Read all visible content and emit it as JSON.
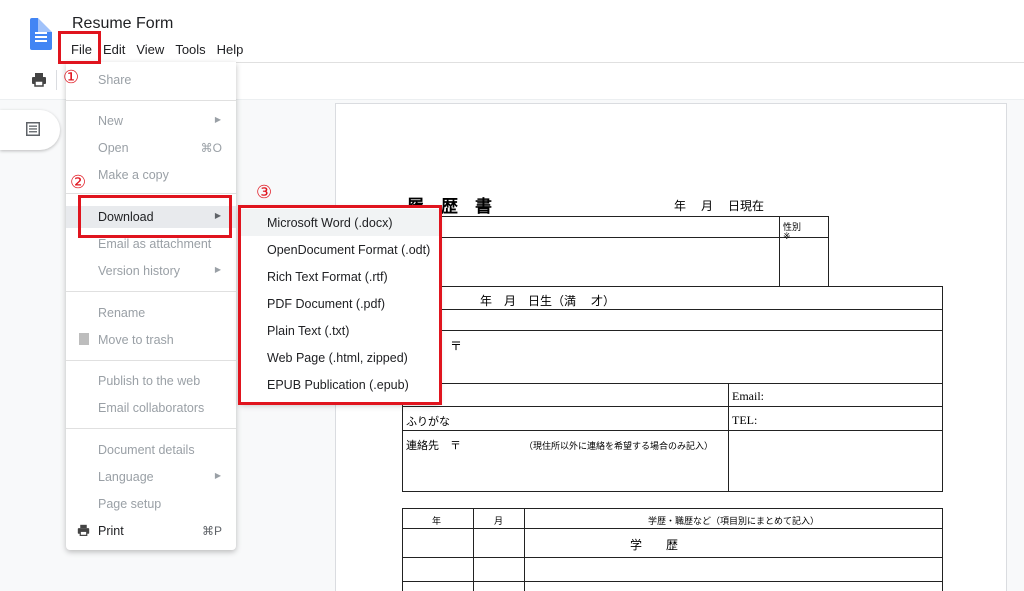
{
  "app": {
    "document_title": "Resume Form",
    "menu": [
      "File",
      "Edit",
      "View",
      "Tools",
      "Help"
    ]
  },
  "file_menu": {
    "items": [
      {
        "label": "Share",
        "shortcut": "",
        "submenu": false
      },
      {
        "label": "New",
        "shortcut": "",
        "submenu": true
      },
      {
        "label": "Open",
        "shortcut": "⌘O",
        "submenu": false
      },
      {
        "label": "Make a copy",
        "shortcut": "",
        "submenu": false
      },
      {
        "label": "Download",
        "shortcut": "",
        "submenu": true
      },
      {
        "label": "Email as attachment",
        "shortcut": "",
        "submenu": false
      },
      {
        "label": "Version history",
        "shortcut": "",
        "submenu": true
      },
      {
        "label": "Rename",
        "shortcut": "",
        "submenu": false
      },
      {
        "label": "Move to trash",
        "shortcut": "",
        "submenu": false
      },
      {
        "label": "Publish to the web",
        "shortcut": "",
        "submenu": false
      },
      {
        "label": "Email collaborators",
        "shortcut": "",
        "submenu": false
      },
      {
        "label": "Document details",
        "shortcut": "",
        "submenu": false
      },
      {
        "label": "Language",
        "shortcut": "",
        "submenu": true
      },
      {
        "label": "Page setup",
        "shortcut": "",
        "submenu": false
      },
      {
        "label": "Print",
        "shortcut": "⌘P",
        "submenu": false
      }
    ]
  },
  "download_submenu": {
    "items": [
      "Microsoft Word (.docx)",
      "OpenDocument Format (.odt)",
      "Rich Text Format (.rtf)",
      "PDF Document (.pdf)",
      "Plain Text (.txt)",
      "Web Page (.html, zipped)",
      "EPUB Publication (.epub)"
    ]
  },
  "annotations": {
    "step1": "①",
    "step2": "②",
    "step3": "③",
    "color": "#e0141e"
  },
  "resume_form": {
    "heading": "履　歴　書",
    "date_now": "年　 月　 日現在",
    "gender": "性別",
    "gender_mark": "※",
    "birth": "年　月　日生（満　 才）",
    "postal_mark": "〒",
    "email": "Email:",
    "furigana": "ふりがな",
    "tel": "TEL:",
    "contact": "連絡先　〒",
    "contact_note": "（現住所以外に連絡を希望する場合のみ記入）",
    "history_year": "年",
    "history_month": "月",
    "history_desc": "学歴・職歴など（項目別にまとめて記入）",
    "education": "学　　歴"
  }
}
